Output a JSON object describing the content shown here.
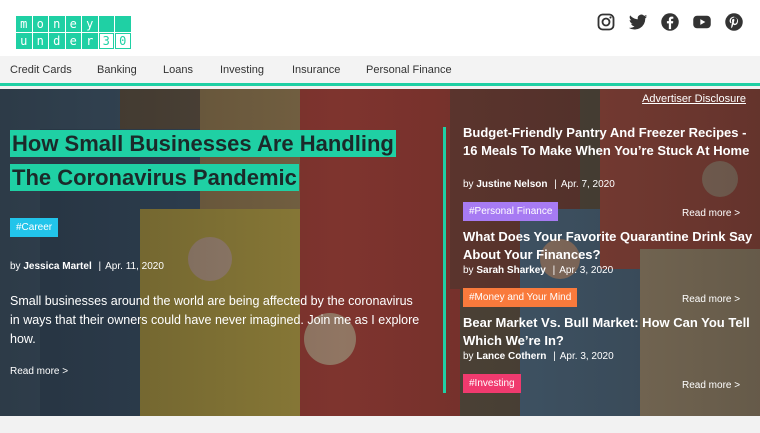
{
  "logo": {
    "row1": [
      "m",
      "o",
      "n",
      "e",
      "y",
      "",
      ""
    ],
    "row2": [
      "u",
      "n",
      "d",
      "e",
      "r",
      "3",
      "0"
    ]
  },
  "social": [
    "instagram-icon",
    "twitter-icon",
    "facebook-icon",
    "youtube-icon",
    "pinterest-icon"
  ],
  "nav": [
    "Credit Cards",
    "Banking",
    "Loans",
    "Investing",
    "Insurance",
    "Personal Finance"
  ],
  "disclosure": "Advertiser Disclosure",
  "main": {
    "title": "How Small Businesses Are Handling The Coronavirus Pandemic",
    "tag": "#Career",
    "by": "by",
    "author": "Jessica Martel",
    "date": "Apr. 11, 2020",
    "excerpt": "Small businesses around the world are being affected by the coronavirus in ways that their owners could have never imagined. Join me as I explore how.",
    "read_more": "Read more >"
  },
  "side": [
    {
      "title": "Budget-Friendly Pantry And Freezer Recipes - 16 Meals To Make When You’re Stuck At Home",
      "by": "by",
      "author": "Justine Nelson",
      "date": "Apr. 7, 2020",
      "tag": "#Personal Finance",
      "tag_color": "#a77bf3",
      "read_more": "Read more >"
    },
    {
      "title": "What Does Your Favorite Quarantine Drink Say About Your Finances?",
      "by": "by",
      "author": "Sarah Sharkey",
      "date": "Apr. 3, 2020",
      "tag": "#Money and Your Mind",
      "tag_color": "#f97a3c",
      "read_more": "Read more >"
    },
    {
      "title": "Bear Market Vs. Bull Market: How Can You Tell Which We’re In?",
      "by": "by",
      "author": "Lance Cothern",
      "date": "Apr. 3, 2020",
      "tag": "#Investing",
      "tag_color": "#f03a6e",
      "read_more": "Read more >"
    }
  ],
  "colors": {
    "accent": "#1fd0a4",
    "career_tag": "#22c4ea"
  }
}
